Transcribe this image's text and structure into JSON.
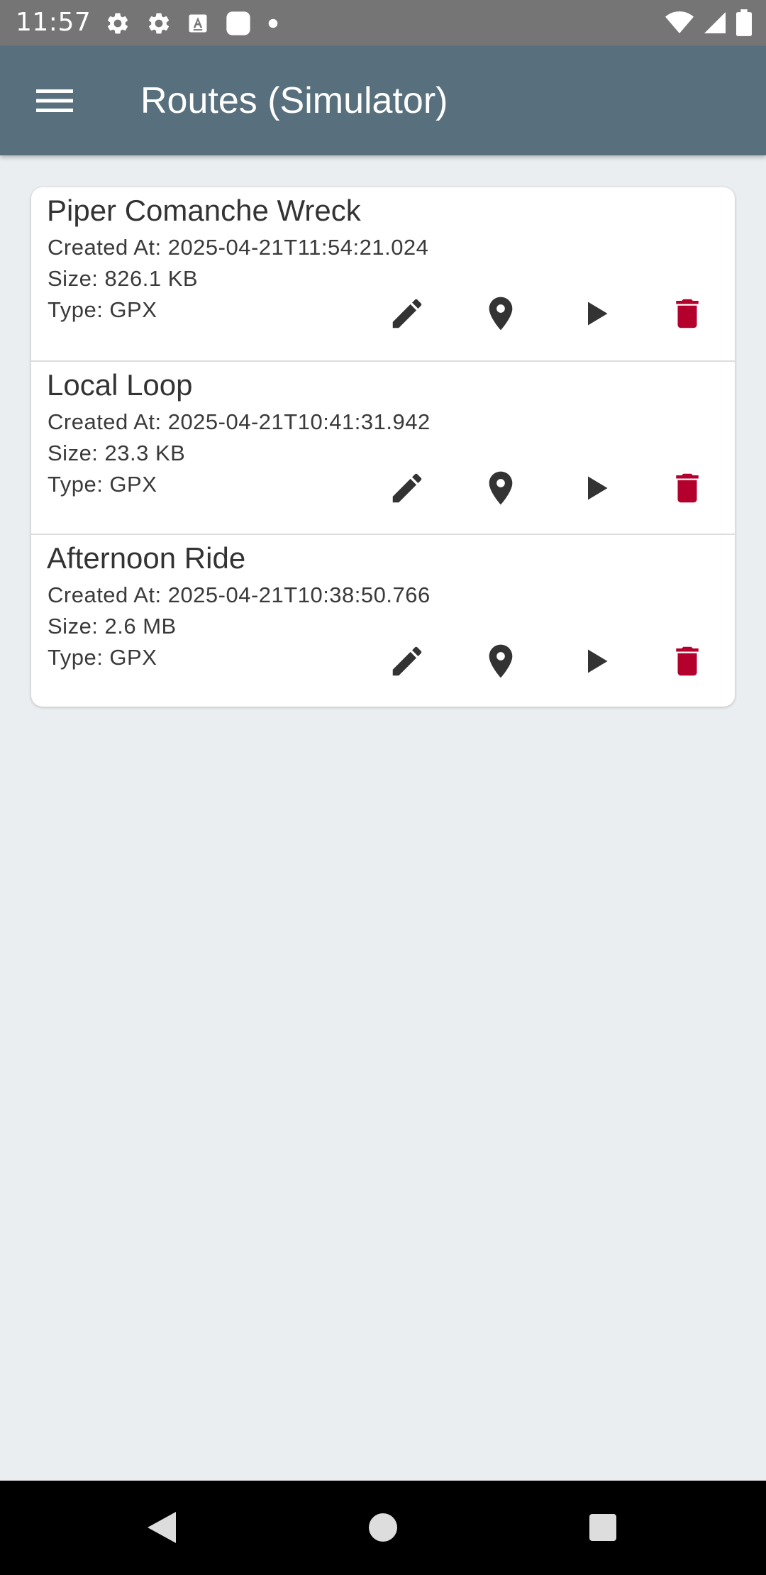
{
  "status_bar": {
    "time": "11:57",
    "left_icons": [
      "gear-icon",
      "gear-icon",
      "font-icon",
      "square-icon",
      "dot-icon"
    ],
    "right_icons": [
      "wifi-icon",
      "signal-icon",
      "battery-icon"
    ]
  },
  "app_bar": {
    "title": "Routes (Simulator)",
    "menu_icon": "hamburger-menu-icon",
    "background_color": "#58707D"
  },
  "routes": [
    {
      "name": "Piper Comanche Wreck",
      "created_at": "Created At: 2025-04-21T11:54:21.024",
      "size": "Size: 826.1 KB",
      "type": "Type: GPX"
    },
    {
      "name": "Local Loop",
      "created_at": "Created At: 2025-04-21T10:41:31.942",
      "size": "Size: 23.3 KB",
      "type": "Type: GPX"
    },
    {
      "name": "Afternoon Ride",
      "created_at": "Created At: 2025-04-21T10:38:50.766",
      "size": "Size: 2.6 MB",
      "type": "Type: GPX"
    }
  ],
  "actions": {
    "icons": [
      "pencil-icon",
      "map-pin-icon",
      "play-icon",
      "trash-icon"
    ],
    "icon_color": "#333333",
    "delete_color": "#B3002D"
  },
  "nav_bar": {
    "icons": [
      "back-triangle-icon",
      "home-circle-icon",
      "recents-square-icon"
    ]
  }
}
